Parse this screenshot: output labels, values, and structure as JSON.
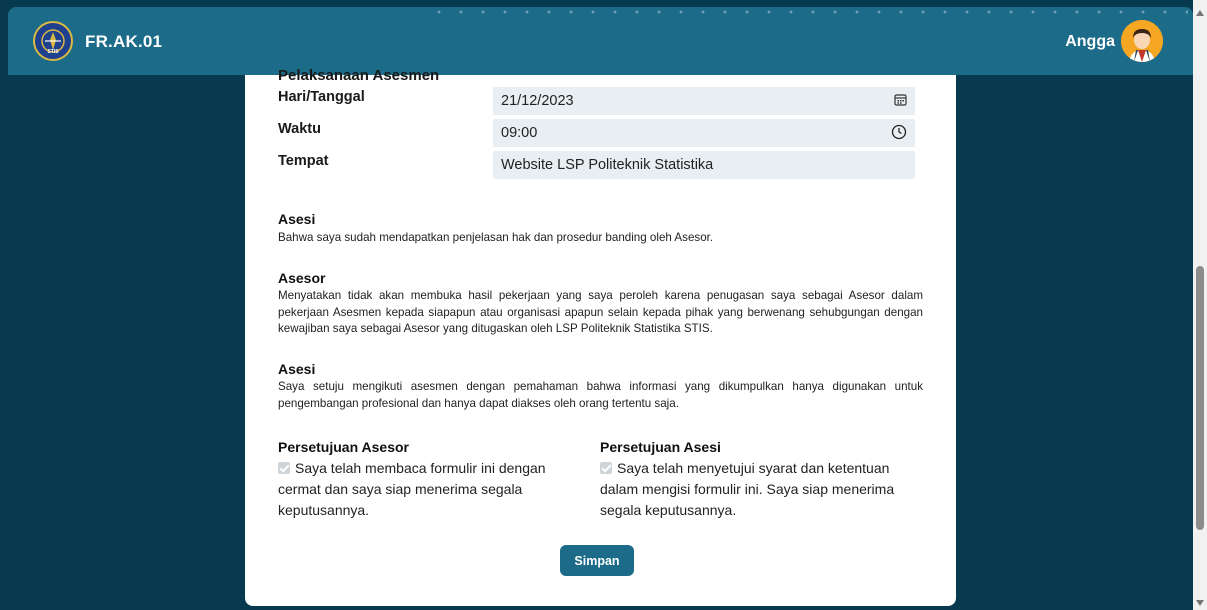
{
  "header": {
    "title": "FR.AK.01",
    "username": "Angga",
    "logo_text": "STIS",
    "bar_color": "#1c6b89"
  },
  "form": {
    "cut_heading": "Pelaksanaan Asesmen",
    "rows": [
      {
        "label": "Hari/Tanggal",
        "value": "21/12/2023",
        "icon": "calendar-icon"
      },
      {
        "label": "Waktu",
        "value": "09:00",
        "icon": "clock-icon"
      },
      {
        "label": "Tempat",
        "value": "Website LSP Politeknik Statistika"
      }
    ]
  },
  "sections": [
    {
      "title": "Asesi",
      "text": "Bahwa saya sudah mendapatkan penjelasan hak dan prosedur banding oleh Asesor."
    },
    {
      "title": "Asesor",
      "text": "Menyatakan tidak akan membuka hasil pekerjaan yang saya peroleh karena penugasan saya sebagai Asesor dalam pekerjaan Asesmen kepada siapapun atau organisasi apapun selain kepada pihak yang berwenang sehubgungan dengan kewajiban saya sebagai Asesor yang ditugaskan oleh LSP Politeknik Statistika STIS."
    },
    {
      "title": "Asesi",
      "text": "Saya setuju mengikuti asesmen dengan pemahaman bahwa informasi yang dikumpulkan hanya digunakan untuk pengembangan profesional dan hanya dapat diakses oleh orang tertentu saja."
    }
  ],
  "consent": {
    "asesor_title": "Persetujuan Asesor",
    "asesor_text": "Saya telah membaca formulir ini dengan cermat dan saya siap menerima segala keputusannya.",
    "asesi_title": "Persetujuan Asesi",
    "asesi_text": "Saya telah menyetujui syarat dan ketentuan dalam mengisi formulir ini. Saya siap menerima segala keputusannya."
  },
  "actions": {
    "save_label": "Simpan"
  }
}
